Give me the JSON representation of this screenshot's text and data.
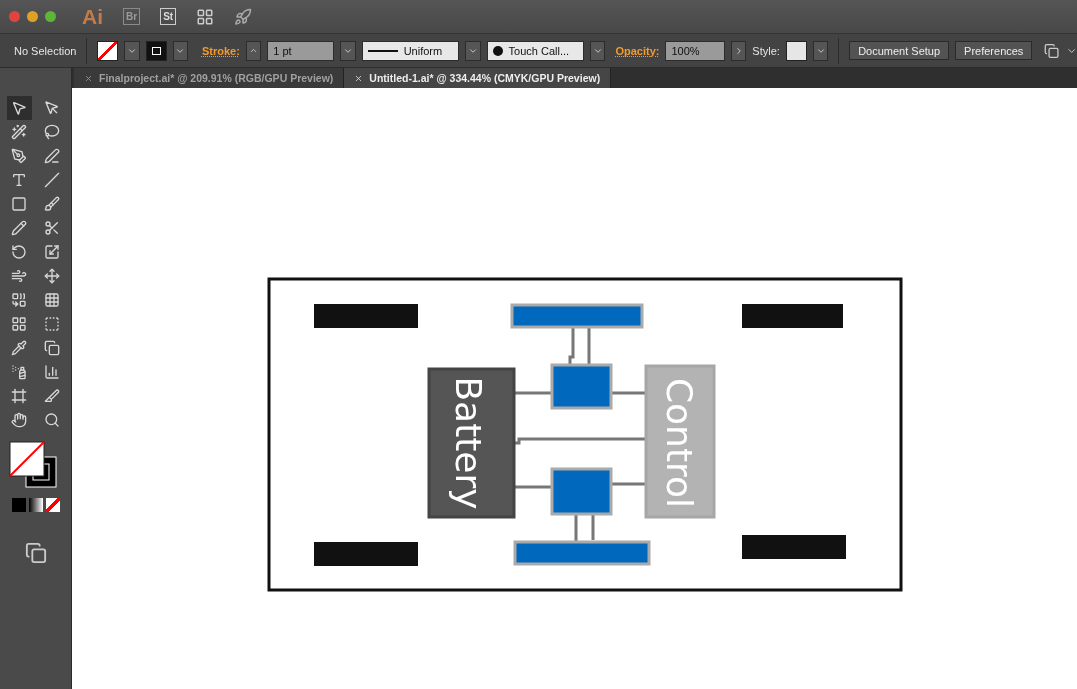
{
  "app_bar": {
    "logo": "Ai",
    "apps": [
      "Br",
      "St"
    ]
  },
  "control_bar": {
    "selection": "No Selection",
    "stroke_label": "Stroke:",
    "stroke_weight": "1 pt",
    "profile": "Uniform",
    "brush": "Touch Call...",
    "opacity_label": "Opacity:",
    "opacity": "100%",
    "style_label": "Style:",
    "buttons": [
      "Document Setup",
      "Preferences"
    ]
  },
  "tabs": [
    {
      "label": "Finalproject.ai* @ 209.91% (RGB/GPU Preview)",
      "selected": false
    },
    {
      "label": "Untitled-1.ai* @ 334.44% (CMYK/GPU Preview)",
      "selected": true
    }
  ],
  "tools": [
    {
      "kind": "select",
      "selected": true
    },
    {
      "kind": "direct",
      "selected": false
    },
    {
      "kind": "wand",
      "selected": false
    },
    {
      "kind": "lasso",
      "selected": false
    },
    {
      "kind": "pen",
      "selected": false
    },
    {
      "kind": "curvature",
      "selected": false
    },
    {
      "kind": "type",
      "selected": false
    },
    {
      "kind": "line",
      "selected": false
    },
    {
      "kind": "rect",
      "selected": false
    },
    {
      "kind": "brush",
      "selected": false
    },
    {
      "kind": "shaper",
      "selected": false
    },
    {
      "kind": "scissors",
      "selected": false
    },
    {
      "kind": "rotate",
      "selected": false
    },
    {
      "kind": "scale",
      "selected": false
    },
    {
      "kind": "warp",
      "selected": false
    },
    {
      "kind": "transform",
      "selected": false
    },
    {
      "kind": "shapebuilder",
      "selected": false
    },
    {
      "kind": "perspective",
      "selected": false
    },
    {
      "kind": "mesh",
      "selected": false
    },
    {
      "kind": "gradient",
      "selected": false
    },
    {
      "kind": "eyedropper",
      "selected": false
    },
    {
      "kind": "blend",
      "selected": false
    },
    {
      "kind": "spray",
      "selected": false
    },
    {
      "kind": "graph",
      "selected": false
    },
    {
      "kind": "artboard",
      "selected": false
    },
    {
      "kind": "slice",
      "selected": false
    },
    {
      "kind": "hand",
      "selected": false
    },
    {
      "kind": "zoom",
      "selected": false
    }
  ],
  "diagram": {
    "battery_label": "Battery",
    "control_label": "Control"
  }
}
